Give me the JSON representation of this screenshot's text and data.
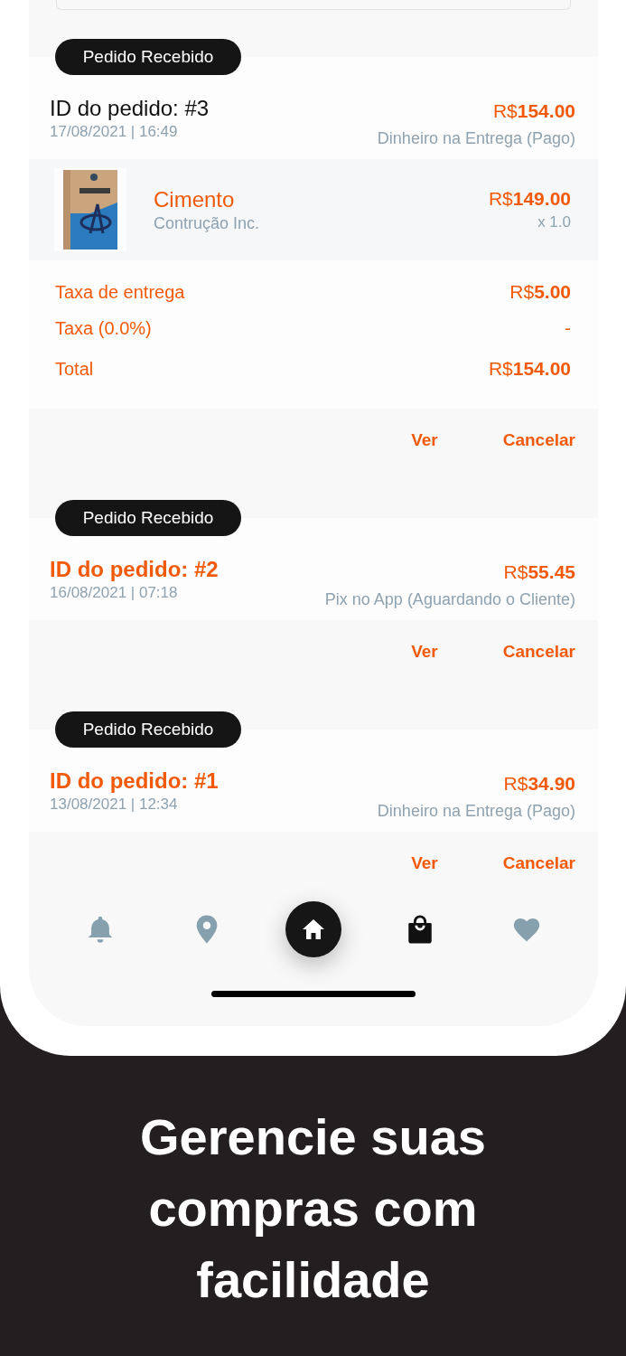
{
  "orders": [
    {
      "status": "Pedido Recebido",
      "id_label": "ID do pedido: #3",
      "highlighted": false,
      "date": "17/08/2021 | 16:49",
      "total": "R$**154.00**",
      "payment": "Dinheiro na Entrega (Pago)",
      "items": [
        {
          "name": "Cimento",
          "seller": "Contrução Inc.",
          "price": "R$**149.00**",
          "quantity": "x 1.0"
        }
      ],
      "fees": [
        {
          "label": "Taxa de entrega",
          "value": "R$**5.00**",
          "kind": "normal"
        },
        {
          "label": "Taxa (0.0%)",
          "value": "-",
          "kind": "normal"
        },
        {
          "label": "Total",
          "value": "R$**154.00**",
          "kind": "total"
        }
      ],
      "actions": [
        "Ver",
        "Cancelar"
      ]
    },
    {
      "status": "Pedido Recebido",
      "id_label": "ID do pedido: #2",
      "highlighted": true,
      "date": "16/08/2021 | 07:18",
      "total": "R$**55.45**",
      "payment": "Pix no App (Aguardando o Cliente)",
      "actions": [
        "Ver",
        "Cancelar"
      ]
    },
    {
      "status": "Pedido Recebido",
      "id_label": "ID do pedido: #1",
      "highlighted": true,
      "date": "13/08/2021 | 12:34",
      "total": "R$**34.90**",
      "payment": "Dinheiro na Entrega (Pago)",
      "actions": [
        "Ver",
        "Cancelar"
      ]
    }
  ],
  "bottom_nav": [
    {
      "kind": "bell",
      "selected": false
    },
    {
      "kind": "pin",
      "selected": false
    },
    {
      "kind": "home",
      "selected": false
    },
    {
      "kind": "bag",
      "selected": true
    },
    {
      "kind": "heart",
      "selected": false
    }
  ],
  "caption": "Gerencie suas compras com facilidade"
}
